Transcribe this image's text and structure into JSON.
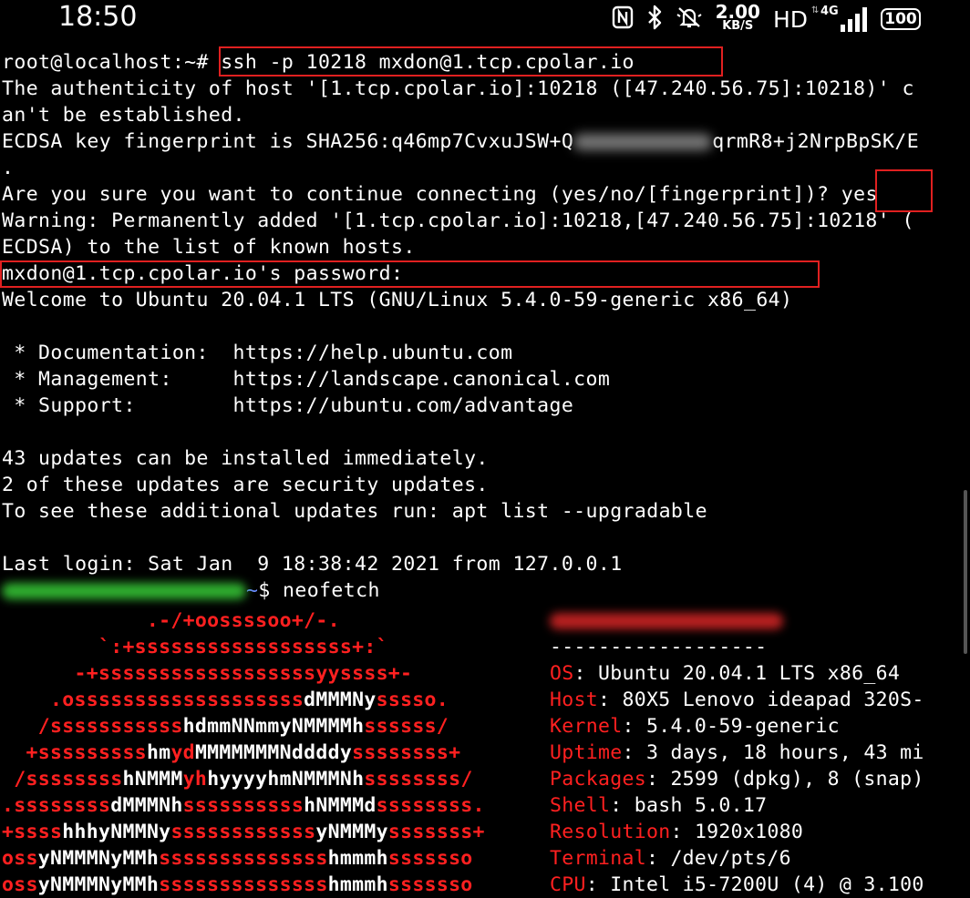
{
  "status_bar": {
    "time": "18:50",
    "speed_value": "2.00",
    "speed_unit": "KB/S",
    "hd": "HD",
    "network": "4G",
    "battery": "100"
  },
  "terminal": {
    "prompt_root": "root@localhost:~# ",
    "command_ssh": "ssh -p 10218 mxdon@1.tcp.cpolar.io",
    "auth_line1": "The authenticity of host '[1.tcp.cpolar.io]:10218 ([47.240.56.75]:10218)' c",
    "auth_line2": "an't be established.",
    "fingerprint_prefix": "ECDSA key fingerprint is SHA256:q46mp7CvxuJSW+Q",
    "fingerprint_suffix": "qrmR8+j2NrpBpSK/E",
    "fingerprint_end": ".",
    "confirm_question": "Are you sure you want to continue connecting (yes/no/[fingerprint])? ",
    "confirm_answer": "yes",
    "warning_line1": "Warning: Permanently added '[1.tcp.cpolar.io]:10218,[47.240.56.75]:10218' (",
    "warning_line2": "ECDSA) to the list of known hosts.",
    "password_prompt": "mxdon@1.tcp.cpolar.io's password:",
    "welcome": "Welcome to Ubuntu 20.04.1 LTS (GNU/Linux 5.4.0-59-generic x86_64)",
    "doc_line": " * Documentation:  https://help.ubuntu.com",
    "mgmt_line": " * Management:     https://landscape.canonical.com",
    "support_line": " * Support:        https://ubuntu.com/advantage",
    "updates1": "43 updates can be installed immediately.",
    "updates2": "2 of these updates are security updates.",
    "updates3": "To see these additional updates run: apt list --upgradable",
    "last_login": "Last login: Sat Jan  9 18:38:42 2021 from 127.0.0.1",
    "prompt_tilde": "~",
    "prompt_dollar": "$ neofetch"
  },
  "neofetch": {
    "art": [
      [
        [
          "r",
          "            .-/+oossssoo+/-."
        ]
      ],
      [
        [
          "r",
          "        `:+ssssssssssssssssss+:`"
        ]
      ],
      [
        [
          "r",
          "      -+ssssssssssssssssssyyssss+-"
        ]
      ],
      [
        [
          "r",
          "    .osssssssssssssssssss"
        ],
        [
          "w",
          "dMMMNy"
        ],
        [
          "r",
          "sssso."
        ]
      ],
      [
        [
          "r",
          "   /sssssssssss"
        ],
        [
          "w",
          "hdmmNNmmyNMMMMh"
        ],
        [
          "r",
          "ssssss/"
        ]
      ],
      [
        [
          "r",
          "  +sssssssss"
        ],
        [
          "w",
          "hm"
        ],
        [
          "r",
          "yd"
        ],
        [
          "w",
          "MMMMMMMNddddy"
        ],
        [
          "r",
          "ssssssss+"
        ]
      ],
      [
        [
          "r",
          " /ssssssss"
        ],
        [
          "w",
          "hNMMM"
        ],
        [
          "r",
          "yh"
        ],
        [
          "w",
          "hyyyyhmNMMMNh"
        ],
        [
          "r",
          "ssssssss/"
        ]
      ],
      [
        [
          "r",
          ".ssssssss"
        ],
        [
          "w",
          "dMMMNh"
        ],
        [
          "r",
          "ssssssssss"
        ],
        [
          "w",
          "hNMMMd"
        ],
        [
          "r",
          "ssssssss."
        ]
      ],
      [
        [
          "r",
          "+ssss"
        ],
        [
          "w",
          "hhhyNMMNy"
        ],
        [
          "r",
          "ssssssssssss"
        ],
        [
          "w",
          "yNMMMy"
        ],
        [
          "r",
          "sssssss+"
        ]
      ],
      [
        [
          "r",
          "oss"
        ],
        [
          "w",
          "yNMMMNyMMh"
        ],
        [
          "r",
          "ssssssssssssss"
        ],
        [
          "w",
          "hmmmh"
        ],
        [
          "r",
          "sssssso"
        ]
      ],
      [
        [
          "r",
          "oss"
        ],
        [
          "w",
          "yNMMMNyMMh"
        ],
        [
          "r",
          "ssssssssssssss"
        ],
        [
          "w",
          "hmmmh"
        ],
        [
          "r",
          "sssssso"
        ]
      ]
    ],
    "separator": "------------------",
    "info": [
      {
        "key": "OS",
        "value": ": Ubuntu 20.04.1 LTS x86_64"
      },
      {
        "key": "Host",
        "value": ": 80X5 Lenovo ideapad 320S-"
      },
      {
        "key": "Kernel",
        "value": ": 5.4.0-59-generic"
      },
      {
        "key": "Uptime",
        "value": ": 3 days, 18 hours, 43 mi"
      },
      {
        "key": "Packages",
        "value": ": 2599 (dpkg), 8 (snap)"
      },
      {
        "key": "Shell",
        "value": ": bash 5.0.17"
      },
      {
        "key": "Resolution",
        "value": ": 1920x1080"
      },
      {
        "key": "Terminal",
        "value": ": /dev/pts/6"
      },
      {
        "key": "CPU",
        "value": ": Intel i5-7200U (4) @ 3.100"
      }
    ]
  }
}
